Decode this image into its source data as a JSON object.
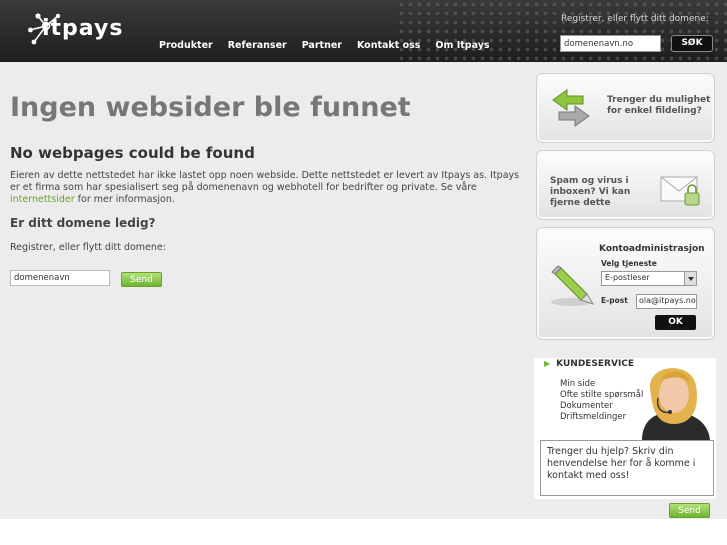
{
  "header": {
    "logo_text": "itpays",
    "nav": [
      "Produkter",
      "Referanser",
      "Partner",
      "Kontakt oss",
      "Om Itpays"
    ],
    "register_label": "Registrer, eller flytt ditt domene:",
    "domain_input_value": "domenenavn.no",
    "search_button": "SØK"
  },
  "main": {
    "title": "Ingen websider ble funnet",
    "subtitle": "No webpages could be found",
    "paragraph_before_link": "Eieren av dette nettstedet har ikke lastet opp noen webside. Dette nettstedet er levert av Itpays as. Itpays er et firma som har spesialisert seg på domenenavn og webhotell for bedrifter og private. Se våre ",
    "paragraph_link": "internettsider",
    "paragraph_after_link": " for mer informasjon.",
    "question": "Er ditt domene ledig?",
    "register_label": "Registrer, eller flytt ditt domene:",
    "domain_input_value": "domenenavn",
    "send_button": "Send"
  },
  "sidebar": {
    "fildeling": "Trenger du mulighet for enkel fildeling?",
    "spam": "Spam og virus i inboxen? Vi kan fjerne dette",
    "konto": {
      "title": "Kontoadministrasjon",
      "service_label": "Velg tjeneste",
      "service_value": "E-postleser",
      "email_label": "E-post",
      "email_value": "ola@itpays.no",
      "ok_button": "OK"
    },
    "kundeservice": {
      "title": "KUNDESERVICE",
      "links": [
        "Min side",
        "Ofte stilte spørsmål",
        "Dokumenter",
        "Driftsmeldinger"
      ],
      "textarea_value": "Trenger du hjelp? Skriv din henvendelse her for å komme i kontakt med oss!",
      "send_button": "Send"
    }
  },
  "colors": {
    "accent_green": "#6eb62f",
    "header_bg": "#2a2a2a",
    "title_gray": "#777777"
  }
}
